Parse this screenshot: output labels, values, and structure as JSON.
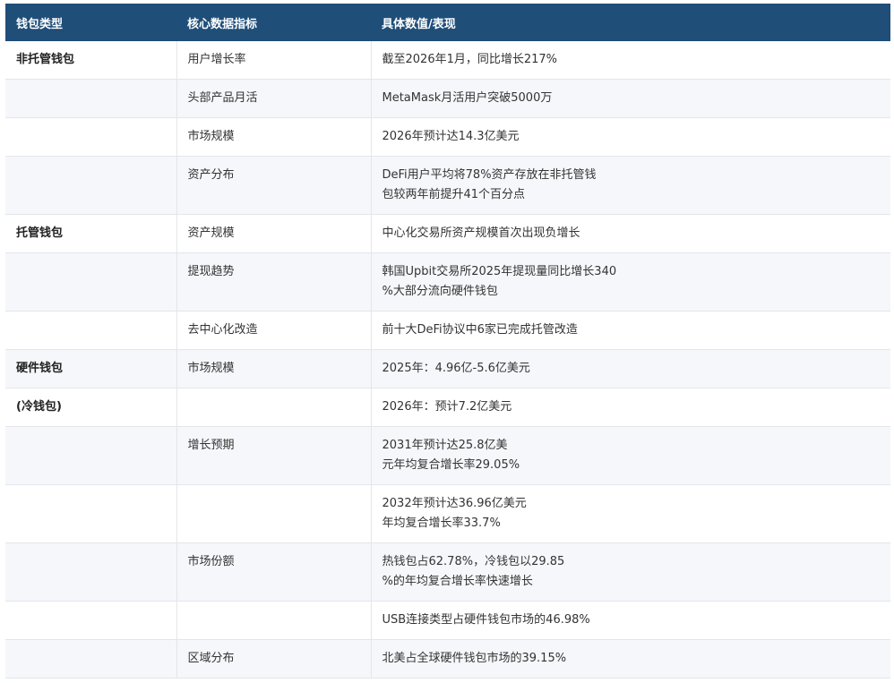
{
  "headers": [
    "钱包类型",
    "核心数据指标",
    "具体数值/表现"
  ],
  "rows": [
    {
      "type": "非托管钱包",
      "metric": "用户增长率",
      "value": "截至2026年1月，同比增长217%"
    },
    {
      "type": "",
      "metric": "头部产品月活",
      "value": "MetaMask月活用户突破5000万"
    },
    {
      "type": "",
      "metric": "市场规模",
      "value": "2026年预计达14.3亿美元"
    },
    {
      "type": "",
      "metric": "资产分布",
      "value": "DeFi用户平均将78%资产存放在非托管钱\n包较两年前提升41个百分点"
    },
    {
      "type": "托管钱包",
      "metric": "资产规模",
      "value": "中心化交易所资产规模首次出现负增长"
    },
    {
      "type": "",
      "metric": "提现趋势",
      "value": "韩国Upbit交易所2025年提现量同比增长340\n%大部分流向硬件钱包"
    },
    {
      "type": "",
      "metric": "去中心化改造",
      "value": "前十大DeFi协议中6家已完成托管改造"
    },
    {
      "type": "硬件钱包",
      "metric": "市场规模",
      "value": "2025年：4.96亿-5.6亿美元"
    },
    {
      "type": "(冷钱包)",
      "metric": "",
      "value": "2026年：预计7.2亿美元"
    },
    {
      "type": "",
      "metric": "增长预期",
      "value": "2031年预计达25.8亿美\n元年均复合增长率29.05%"
    },
    {
      "type": "",
      "metric": "",
      "value": "2032年预计达36.96亿美元\n年均复合增长率33.7%"
    },
    {
      "type": "",
      "metric": "市场份额",
      "value": "热钱包占62.78%，冷钱包以29.85\n%的年均复合增长率快速增长"
    },
    {
      "type": "",
      "metric": "",
      "value": "USB连接类型占硬件钱包市场的46.98%"
    },
    {
      "type": "",
      "metric": "区域分布",
      "value": "北美占全球硬件钱包市场的39.15%"
    }
  ]
}
